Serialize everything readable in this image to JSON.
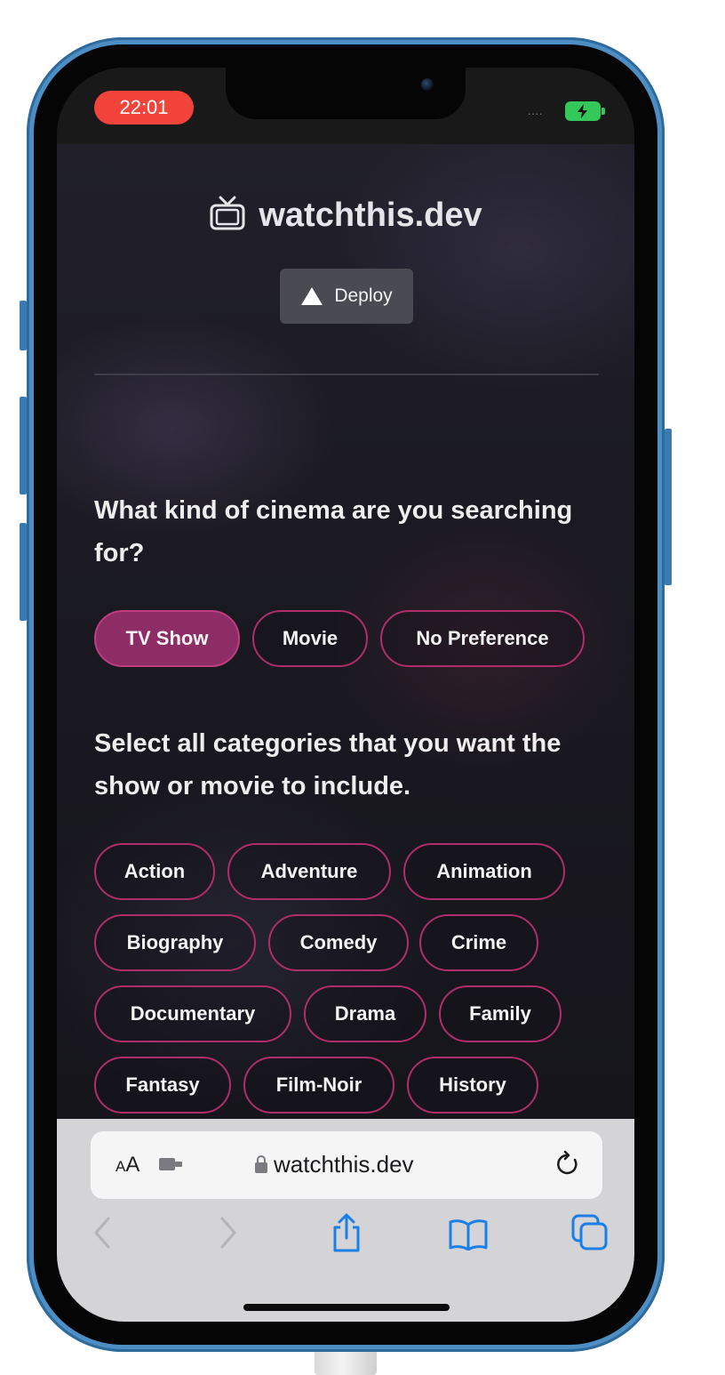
{
  "status_bar": {
    "time": "22:01",
    "signal": "....",
    "battery_icon": "battery-charging-icon"
  },
  "page": {
    "brand_icon": "tv-icon",
    "brand_title": "watchthis.dev",
    "deploy_button": "Deploy",
    "question_type": "What kind of cinema are you searching for?",
    "type_options": [
      {
        "label": "TV Show",
        "selected": true
      },
      {
        "label": "Movie",
        "selected": false
      },
      {
        "label": "No Preference",
        "selected": false
      }
    ],
    "question_categories": "Select all categories that you want the show or movie to include.",
    "categories": [
      "Action",
      "Adventure",
      "Animation",
      "Biography",
      "Comedy",
      "Crime",
      "Documentary",
      "Drama",
      "Family",
      "Fantasy",
      "Film-Noir",
      "History"
    ]
  },
  "browser": {
    "aa_label_small": "A",
    "aa_label_big": "A",
    "url": "watchthis.dev",
    "icons": [
      "extension-icon",
      "lock-icon",
      "reload-icon",
      "back-icon",
      "forward-icon",
      "share-icon",
      "bookmarks-icon",
      "tabs-icon"
    ]
  },
  "colors": {
    "accent": "#b02d6a",
    "selected_fill": "#8e2c66",
    "time_pill": "#f2443a",
    "battery": "#34c759",
    "safari_blue": "#1a7fe6"
  }
}
